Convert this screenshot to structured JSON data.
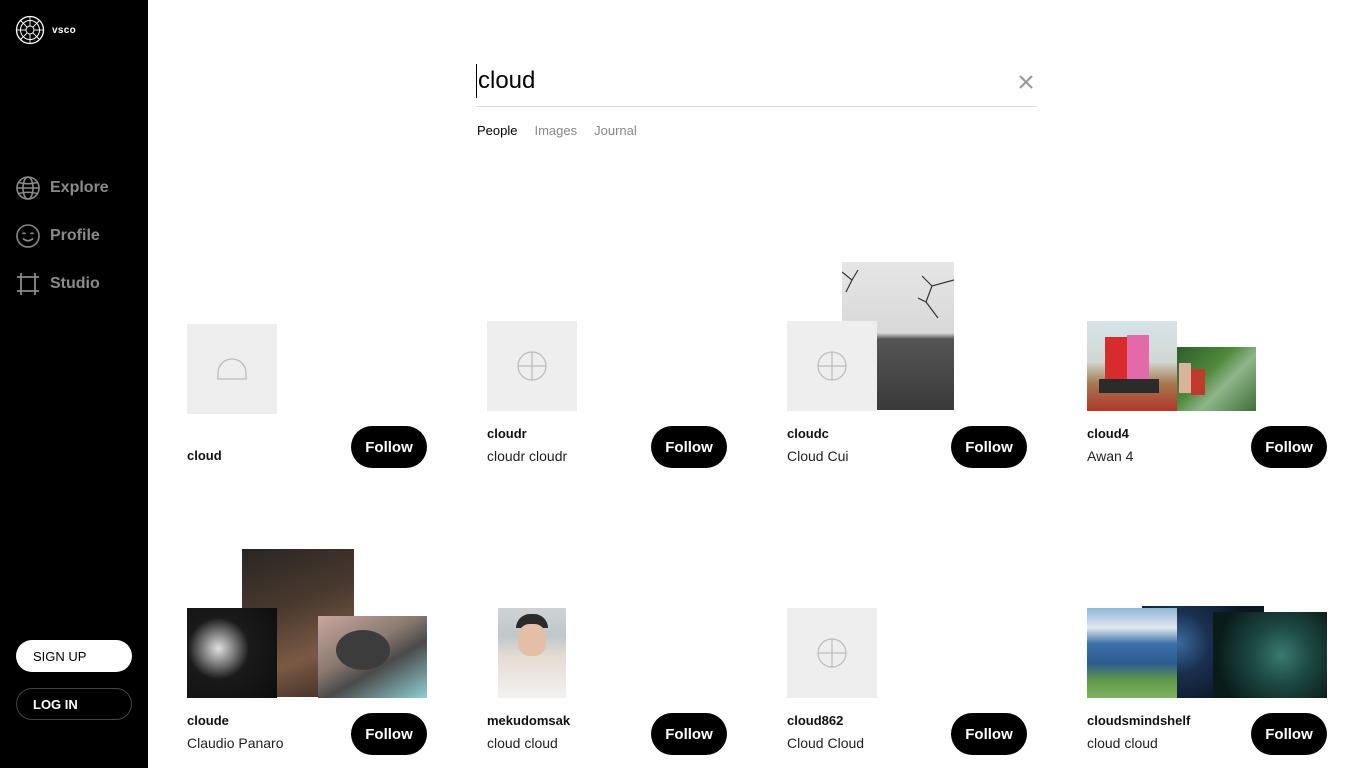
{
  "brand": {
    "name": "vsco"
  },
  "nav": [
    {
      "label": "Explore",
      "icon": "globe-icon"
    },
    {
      "label": "Profile",
      "icon": "smiley-icon"
    },
    {
      "label": "Studio",
      "icon": "crop-icon"
    }
  ],
  "auth": {
    "signup": "SIGN UP",
    "login": "LOG IN"
  },
  "search": {
    "value": "cloud"
  },
  "tabs": [
    {
      "label": "People",
      "active": true
    },
    {
      "label": "Images",
      "active": false
    },
    {
      "label": "Journal",
      "active": false
    }
  ],
  "results": [
    {
      "username": "cloud",
      "display_name": "",
      "follow": "Follow"
    },
    {
      "username": "cloudr",
      "display_name": "cloudr cloudr",
      "follow": "Follow"
    },
    {
      "username": "cloudc",
      "display_name": "Cloud Cui",
      "follow": "Follow"
    },
    {
      "username": "cloud4",
      "display_name": "Awan 4",
      "follow": "Follow"
    },
    {
      "username": "cloude",
      "display_name": "Claudio Panaro",
      "follow": "Follow"
    },
    {
      "username": "mekudomsak",
      "display_name": "cloud cloud",
      "follow": "Follow"
    },
    {
      "username": "cloud862",
      "display_name": "Cloud Cloud",
      "follow": "Follow"
    },
    {
      "username": "cloudsmindshelf",
      "display_name": "cloud cloud",
      "follow": "Follow"
    }
  ],
  "colors": {
    "sidebar": "#000000",
    "accent": "#000000",
    "placeholder": "#eeeeee"
  }
}
